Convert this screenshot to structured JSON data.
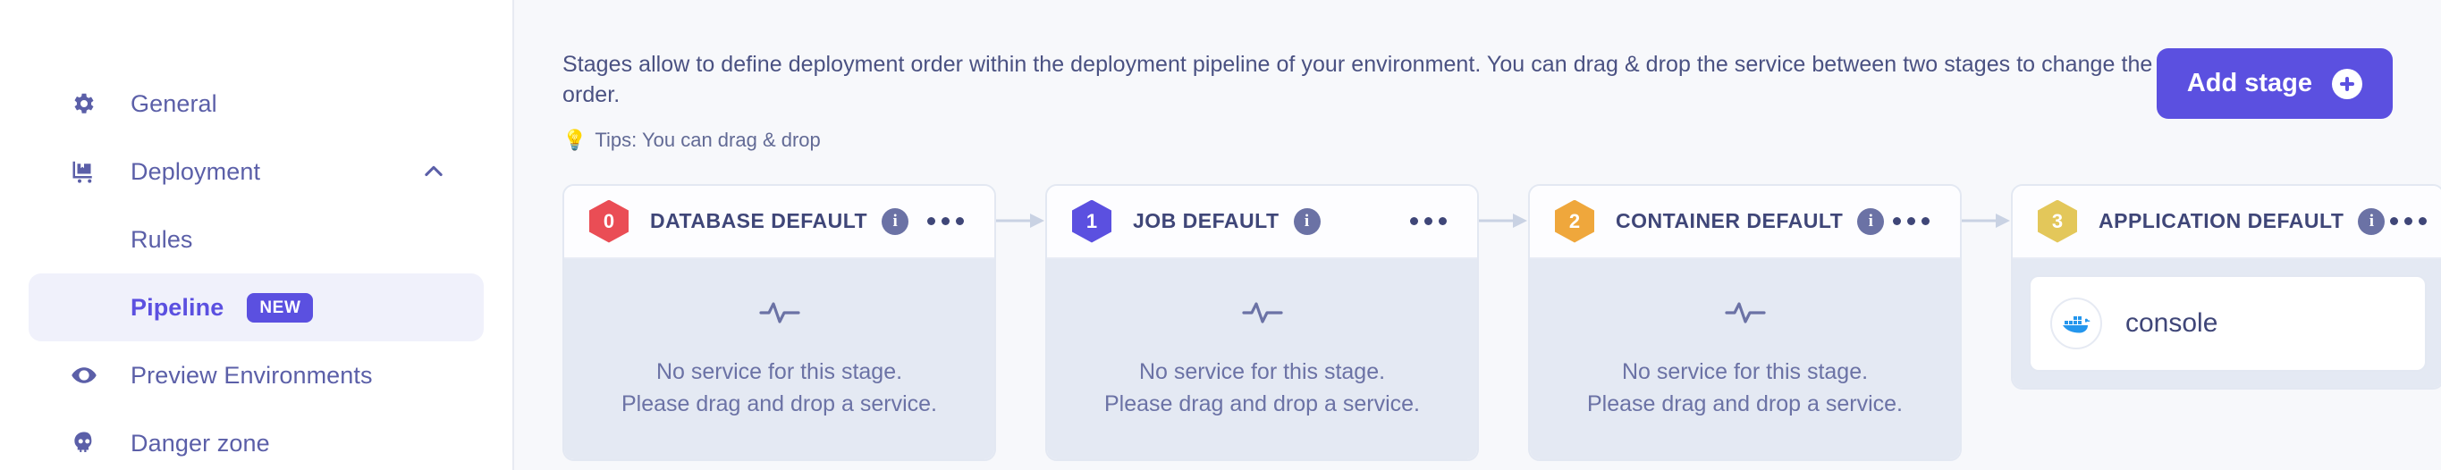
{
  "sidebar": {
    "items": [
      {
        "label": "General",
        "icon": "gear-icon",
        "name": "general"
      },
      {
        "label": "Deployment",
        "icon": "deployment-cart-icon",
        "name": "deployment",
        "chevron": "chevron-up-icon"
      },
      {
        "label": "Rules",
        "icon": null,
        "name": "rules"
      },
      {
        "label": "Pipeline",
        "icon": null,
        "name": "pipeline",
        "badge": "NEW"
      },
      {
        "label": "Preview Environments",
        "icon": "eye-icon",
        "name": "preview-environments"
      },
      {
        "label": "Danger zone",
        "icon": "skull-icon",
        "name": "danger-zone"
      }
    ],
    "active_item": "Pipeline",
    "badge_new": "NEW"
  },
  "main": {
    "description": "Stages allow to define deployment order within the deployment pipeline of your environment. You can drag & drop the service between two stages to change the order.",
    "tips": "Tips: You can drag & drop",
    "tips_emoji": "💡",
    "add_stage_label": "Add stage",
    "empty_line1": "No service for this stage.",
    "empty_line2": "Please drag and drop a service.",
    "stages": [
      {
        "index": "0",
        "title": "DATABASE DEFAULT",
        "color": "#ea4d55",
        "services": []
      },
      {
        "index": "1",
        "title": "JOB DEFAULT",
        "color": "#5b50e0",
        "services": []
      },
      {
        "index": "2",
        "title": "CONTAINER DEFAULT",
        "color": "#efa73c",
        "services": []
      },
      {
        "index": "3",
        "title": "APPLICATION DEFAULT",
        "color": "#e3c75a",
        "services": [
          {
            "name": "console",
            "logo": "docker-icon"
          }
        ]
      }
    ]
  },
  "colors": {
    "accent": "#5b50e0",
    "sidebar_text": "#5b5fa8",
    "heading_text": "#3f4678",
    "dropzone_bg": "#e4e9f3",
    "main_bg": "#f7f8fb"
  }
}
